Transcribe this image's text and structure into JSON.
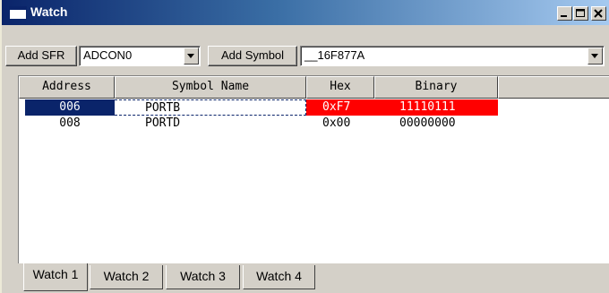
{
  "window": {
    "title": "Watch"
  },
  "toolbar": {
    "add_sfr_label": "Add SFR",
    "sfr_selected": "ADCON0",
    "add_symbol_label": "Add Symbol",
    "symbol_selected": "__16F877A"
  },
  "table": {
    "columns": [
      "Address",
      "Symbol Name",
      "Hex",
      "Binary"
    ],
    "rows": [
      {
        "address": "006",
        "symbol": "PORTB",
        "hex": "0xF7",
        "binary": "11110111",
        "selected": true,
        "changed": true
      },
      {
        "address": "008",
        "symbol": "PORTD",
        "hex": "0x00",
        "binary": "00000000",
        "selected": false,
        "changed": false
      }
    ]
  },
  "tabs": [
    "Watch 1",
    "Watch 2",
    "Watch 3",
    "Watch 4"
  ],
  "active_tab": "Watch 1",
  "colors": {
    "title_start": "#0a246a",
    "selection": "#0a246a",
    "changed_value": "#ff0000",
    "face": "#d4d0c8"
  }
}
